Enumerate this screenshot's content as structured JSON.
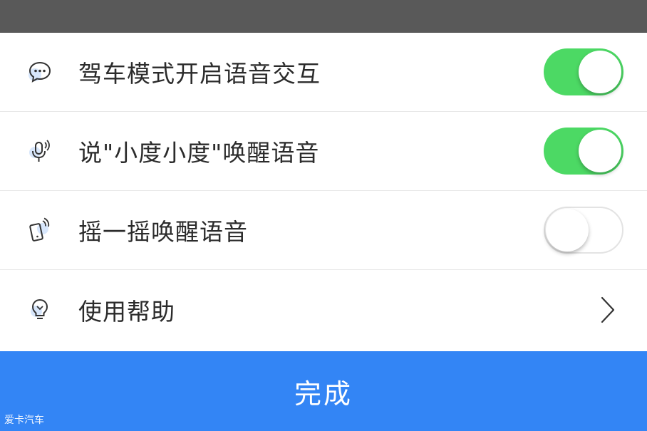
{
  "settings": {
    "items": [
      {
        "icon": "chat-bubble-icon",
        "label": "驾车模式开启语音交互",
        "control": "toggle",
        "enabled": true
      },
      {
        "icon": "microphone-icon",
        "label": "说\"小度小度\"唤醒语音",
        "control": "toggle",
        "enabled": true
      },
      {
        "icon": "shake-phone-icon",
        "label": "摇一摇唤醒语音",
        "control": "toggle",
        "enabled": false
      },
      {
        "icon": "lightbulb-icon",
        "label": "使用帮助",
        "control": "chevron"
      }
    ]
  },
  "footer": {
    "done_label": "完成"
  },
  "watermark": {
    "text": "爱卡汽车"
  },
  "colors": {
    "toggle_on": "#4cd964",
    "primary_button": "#3385f5",
    "top_bar": "#595959"
  }
}
